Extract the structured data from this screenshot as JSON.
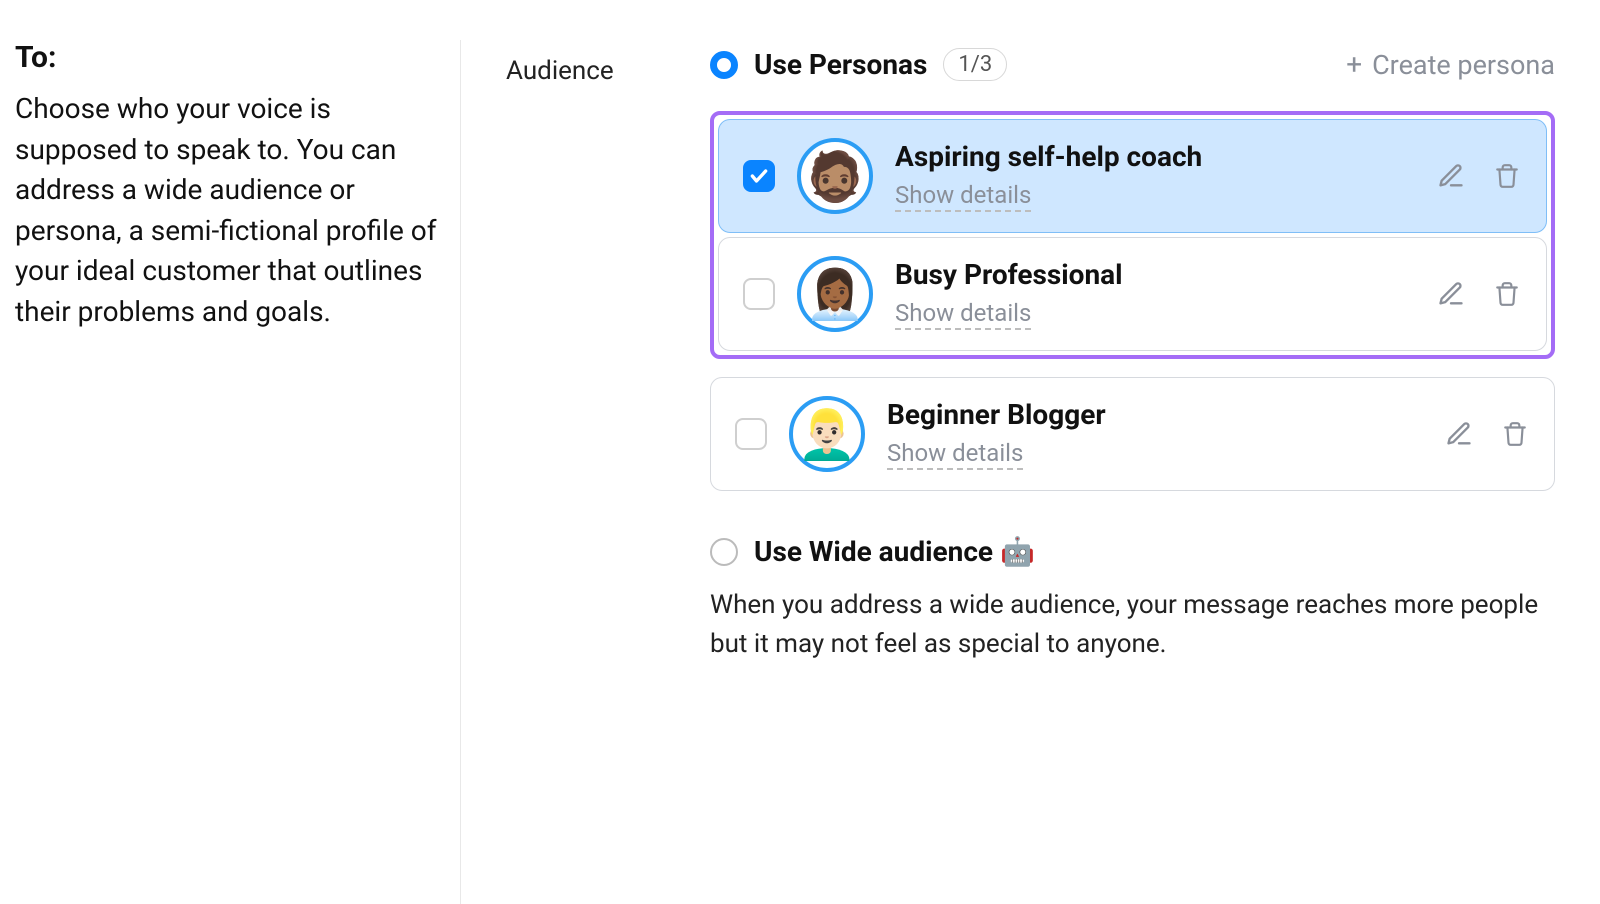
{
  "left": {
    "title": "To:",
    "description": "Choose who your voice is supposed to speak to. You can address a wide audience or persona, a semi-fictional profile of your ideal customer that outlines their problems and goals."
  },
  "section_label": "Audience",
  "use_personas": {
    "label": "Use Personas",
    "badge": "1/3"
  },
  "create_persona_label": "Create persona",
  "personas": [
    {
      "name": "Aspiring self-help coach",
      "show_details": "Show details",
      "emoji": "🧔🏽",
      "checked": true
    },
    {
      "name": "Busy Professional",
      "show_details": "Show details",
      "emoji": "👩🏾‍💼",
      "checked": false
    },
    {
      "name": "Beginner Blogger",
      "show_details": "Show details",
      "emoji": "👱🏻‍♂️",
      "checked": false
    }
  ],
  "wide_audience": {
    "label": "Use Wide audience",
    "emoji": "🤖",
    "description": "When you address a wide audience, your message reaches more people but it may not feel as special to anyone."
  }
}
